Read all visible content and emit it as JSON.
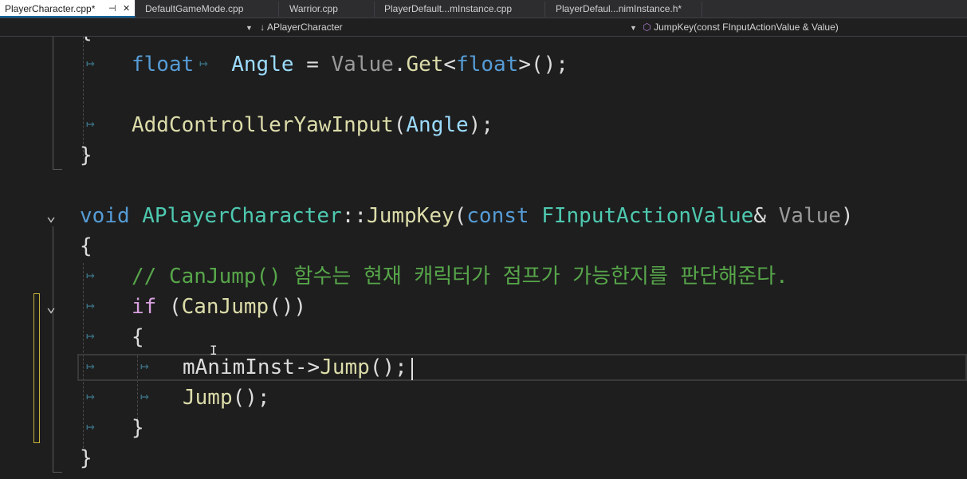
{
  "tabs": [
    {
      "label": "PlayerCharacter.cpp*",
      "active": true,
      "pin_icon": "pin-icon",
      "close_icon": "close-icon"
    },
    {
      "label": "DefaultGameMode.cpp",
      "active": false
    },
    {
      "label": "Warrior.cpp",
      "active": false
    },
    {
      "label": "PlayerDefault...mInstance.cpp",
      "active": false
    },
    {
      "label": "PlayerDefaul...nimInstance.h*",
      "active": false
    }
  ],
  "navbar": {
    "class_scope": "APlayerCharacter",
    "member_scope": "JumpKey(const FInputActionValue & Value)",
    "class_icon": "class-icon",
    "method_icon": "method-icon"
  },
  "code": {
    "line_float": {
      "kw": "float",
      "var": "Angle",
      "eq": "=",
      "param": "Value",
      "dot": ".",
      "fn": "Get",
      "lt": "<",
      "tkw": "float",
      "rest": ">();"
    },
    "line_yaw": {
      "fn": "AddControllerYawInput",
      "open": "(",
      "var": "Angle",
      "close": ");"
    },
    "close_brace": "}",
    "open_brace": "{",
    "line_sig": {
      "kw": "void",
      "cls": "APlayerCharacter",
      "sep": "::",
      "fn": "JumpKey",
      "open": "(",
      "const": "const",
      "type": "FInputActionValue",
      "amp": "&",
      "param": "Value",
      "close": ")"
    },
    "comment": "// CanJump() 함수는 현재 캐릭터가 점프가 가능한지를 판단해준다.",
    "line_if": {
      "kw": "if",
      "open": "(",
      "fn": "CanJump",
      "rest": "())"
    },
    "line_anim": {
      "var": "mAnimInst",
      "arrow": "->",
      "fn": "Jump",
      "rest": "();"
    },
    "line_jump": {
      "fn": "Jump",
      "rest": "();"
    }
  },
  "colors": {
    "keyword": "#569cd6",
    "control": "#d8a0df",
    "type": "#4ec9b0",
    "function": "#dcdcaa",
    "variable": "#9cdcfe",
    "parameter": "#9a9a9a",
    "comment": "#57a64a",
    "change_marker": "#c5b33b"
  }
}
